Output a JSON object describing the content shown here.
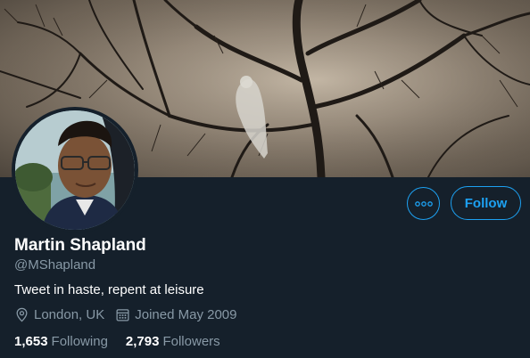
{
  "profile": {
    "name": "Martin Shapland",
    "handle": "@MShapland",
    "bio": "Tweet in haste, repent at leisure",
    "location": "London, UK",
    "joined": "Joined May 2009",
    "following_count": "1,653",
    "following_label": "Following",
    "followers_count": "2,793",
    "followers_label": "Followers"
  },
  "actions": {
    "more_icon": "more-horizontal-icon",
    "follow_label": "Follow"
  },
  "colors": {
    "background": "#15202b",
    "accent": "#1da1f2",
    "secondary_text": "#8899a6"
  }
}
